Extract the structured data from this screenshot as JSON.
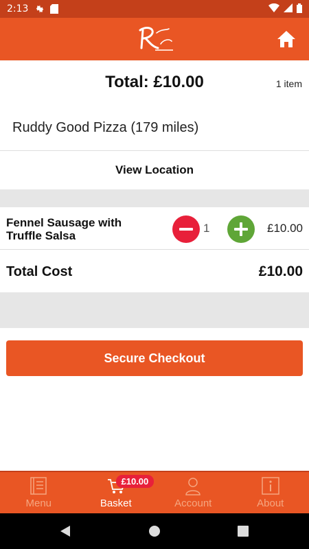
{
  "status_bar": {
    "time": "2:13"
  },
  "header": {
    "logo_icon": "ruddy-good-logo",
    "home_icon": "home-icon"
  },
  "summary": {
    "total_label": "Total: £10.00",
    "item_count": "1 item"
  },
  "restaurant": {
    "name": "Ruddy Good Pizza (179 miles)",
    "view_location_label": "View Location"
  },
  "basket": {
    "items": [
      {
        "name": "Fennel Sausage with Truffle Salsa",
        "quantity": "1",
        "price": "£10.00"
      }
    ],
    "total_cost_label": "Total Cost",
    "total_cost_value": "£10.00"
  },
  "checkout": {
    "label": "Secure Checkout"
  },
  "bottom_nav": {
    "items": [
      {
        "label": "Menu",
        "icon": "menu-book-icon"
      },
      {
        "label": "Basket",
        "icon": "cart-icon",
        "badge": "£10.00"
      },
      {
        "label": "Account",
        "icon": "person-icon"
      },
      {
        "label": "About",
        "icon": "info-icon"
      }
    ],
    "active": "Basket"
  },
  "colors": {
    "brand": "#e95624",
    "status_bar": "#c4401a",
    "minus": "#e8203a",
    "plus": "#5fa637",
    "badge": "#e8203a",
    "divider_bg": "#e6e6e6"
  }
}
